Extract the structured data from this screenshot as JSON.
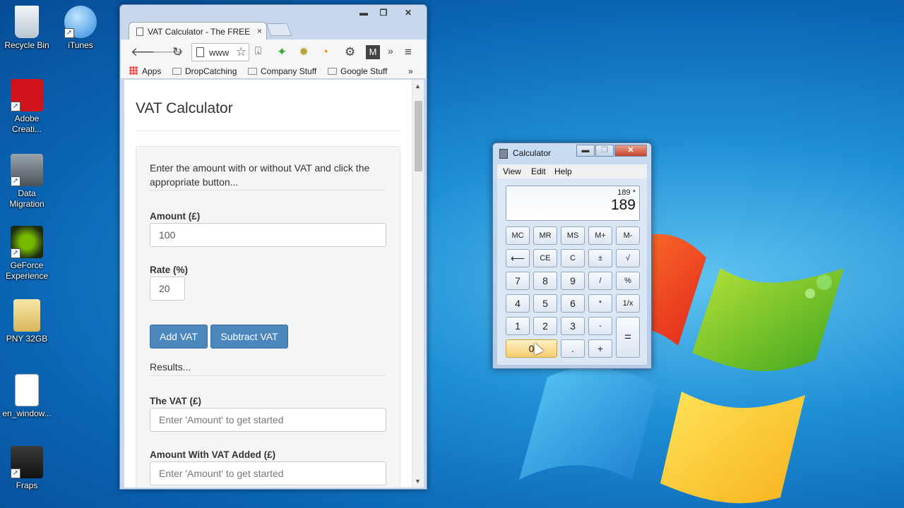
{
  "desktop": {
    "icons": [
      {
        "label": "Recycle Bin"
      },
      {
        "label": "iTunes"
      },
      {
        "label": "Adobe Creati..."
      },
      {
        "label": "Data Migration"
      },
      {
        "label": "GeForce Experience"
      },
      {
        "label": "PNY 32GB"
      },
      {
        "label": "en_window..."
      },
      {
        "label": "Fraps"
      }
    ]
  },
  "browser": {
    "tab_title": "VAT Calculator - The FREE",
    "tab_close": "×",
    "omnibox_text": "www",
    "bookmarks": {
      "apps": "Apps",
      "items": [
        "DropCatching",
        "Company Stuff",
        "Google Stuff"
      ],
      "overflow": "»"
    },
    "window_controls": {
      "minimize": "▬",
      "maximize": "❐",
      "close": "✕"
    }
  },
  "page": {
    "title": "VAT Calculator",
    "intro": "Enter the amount with or without VAT and click the appropriate button...",
    "amount_label": "Amount (£)",
    "amount_value": "100",
    "rate_label": "Rate (%)",
    "rate_value": "20",
    "add_vat_label": "Add VAT",
    "subtract_vat_label": "Subtract VAT",
    "results_label": "Results...",
    "vat_label": "The VAT (£)",
    "vat_placeholder": "Enter 'Amount' to get started",
    "with_vat_label": "Amount With VAT Added (£)",
    "with_vat_placeholder": "Enter 'Amount' to get started"
  },
  "calculator": {
    "title": "Calculator",
    "menu": [
      "View",
      "Edit",
      "Help"
    ],
    "expression": "189 *",
    "value": "189",
    "keys": {
      "mc": "MC",
      "mr": "MR",
      "ms": "MS",
      "mplus": "M+",
      "mminus": "M-",
      "back": "⟵",
      "ce": "CE",
      "c": "C",
      "pm": "±",
      "sqrt": "√",
      "n7": "7",
      "n8": "8",
      "n9": "9",
      "div": "/",
      "pct": "%",
      "n4": "4",
      "n5": "5",
      "n6": "6",
      "mul": "*",
      "inv": "1/x",
      "n1": "1",
      "n2": "2",
      "n3": "3",
      "sub": "-",
      "eq": "=",
      "n0": "0",
      "dot": ".",
      "add": "+"
    }
  }
}
